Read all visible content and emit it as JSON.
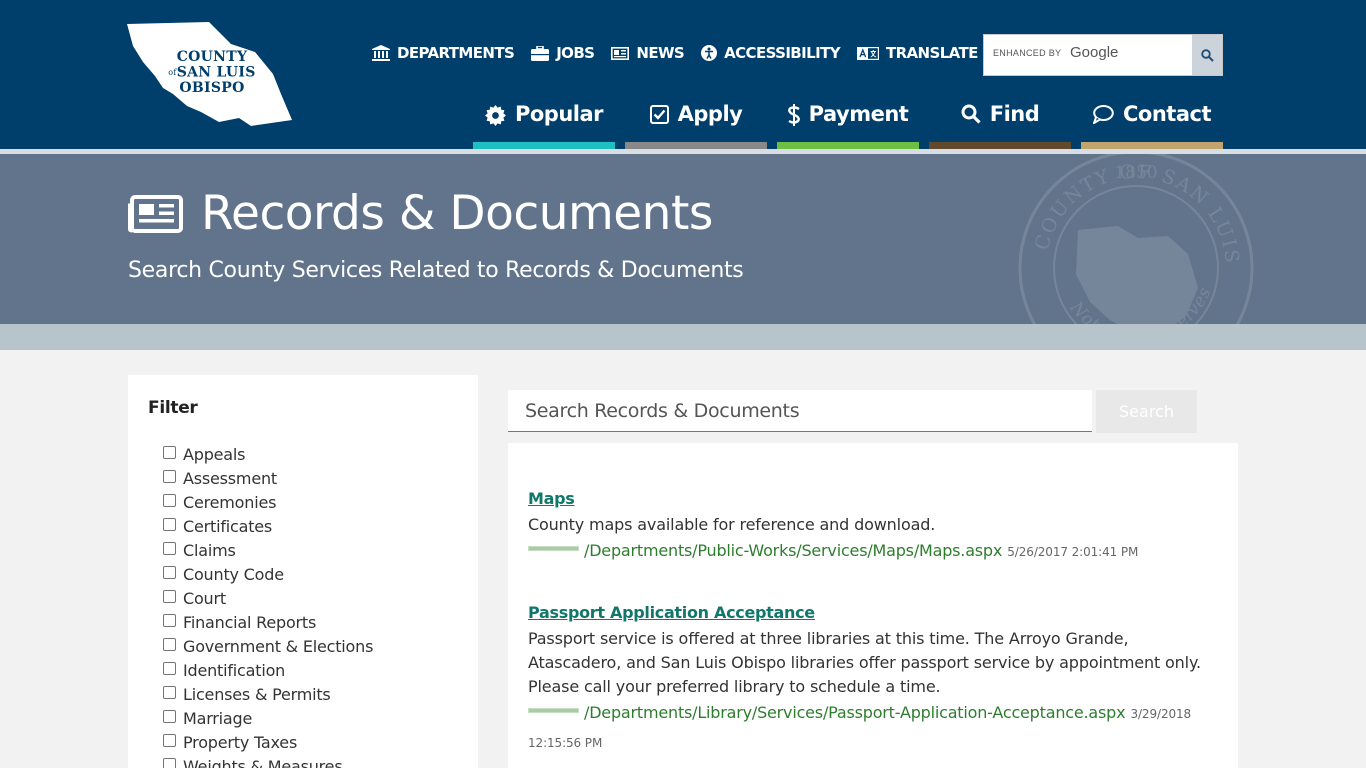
{
  "logo": {
    "line1": "COUNTY",
    "of": "of",
    "line2": "SAN LUIS",
    "line3": "OBISPO"
  },
  "utility_nav": [
    {
      "label": "DEPARTMENTS",
      "icon": "building-icon"
    },
    {
      "label": "JOBS",
      "icon": "briefcase-icon"
    },
    {
      "label": "NEWS",
      "icon": "newspaper-icon"
    },
    {
      "label": "ACCESSIBILITY",
      "icon": "accessibility-icon"
    },
    {
      "label": "TRANSLATE",
      "icon": "translate-icon"
    }
  ],
  "google_search": {
    "enhanced": "ENHANCED BY",
    "brand": "Google",
    "button_icon": "search-icon"
  },
  "main_nav": [
    {
      "label": "Popular",
      "icon": "gear-icon",
      "color": "#1fc0c1"
    },
    {
      "label": "Apply",
      "icon": "checkbox-icon",
      "color": "#888888"
    },
    {
      "label": "Payment",
      "icon": "dollar-icon",
      "color": "#6dc044"
    },
    {
      "label": "Find",
      "icon": "search-icon",
      "color": "#63492b"
    },
    {
      "label": "Contact",
      "icon": "chat-icon",
      "color": "#c1a46d"
    }
  ],
  "hero": {
    "title": "Records & Documents",
    "subtitle": "Search County Services Related to Records & Documents",
    "seal_text": "COUNTY OF SAN LUIS OBISPO",
    "seal_year": "1850",
    "seal_motto": "Not For Ourselves Alone"
  },
  "filter": {
    "heading": "Filter",
    "options": [
      "Appeals",
      "Assessment",
      "Ceremonies",
      "Certificates",
      "Claims",
      "County Code",
      "Court",
      "Financial Reports",
      "Government & Elections",
      "Identification",
      "Licenses & Permits",
      "Marriage",
      "Property Taxes",
      "Weights & Measures"
    ]
  },
  "search": {
    "placeholder": "Search Records & Documents",
    "button": "Search"
  },
  "results": [
    {
      "title": "Maps",
      "description": "County maps available for reference and download.",
      "url": "/Departments/Public-Works/Services/Maps/Maps.aspx",
      "date": "5/26/2017 2:01:41 PM"
    },
    {
      "title": "Passport Application Acceptance",
      "description": "Passport service is offered at three libraries at this time. The Arroyo Grande, Atascadero, and San Luis Obispo libraries offer passport service by appointment only. Please call your preferred library to schedule a time.",
      "url": "/Departments/Library/Services/Passport-Application-Acceptance.aspx",
      "date": "3/29/2018 12:15:56 PM"
    }
  ],
  "colors": {
    "header": "#003e6b",
    "hero": "#62748b",
    "link": "#11776b",
    "url": "#2e7d2e"
  }
}
